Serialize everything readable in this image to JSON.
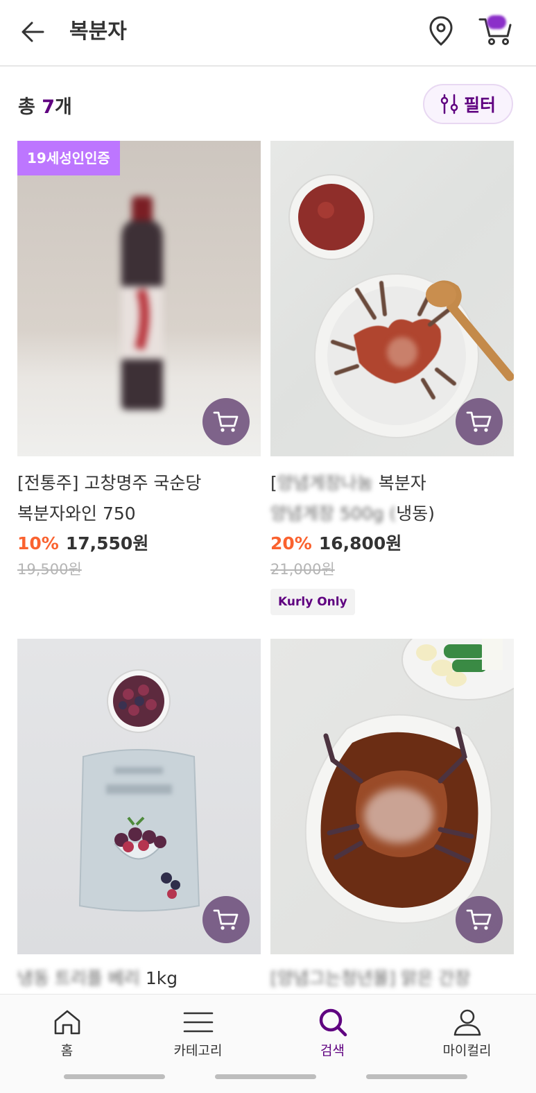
{
  "header": {
    "title": "복분자",
    "back_icon": "back-arrow-icon",
    "location_icon": "location-pin-icon",
    "cart_icon": "cart-icon"
  },
  "summary": {
    "count_prefix": "총 ",
    "count_value": "7",
    "count_suffix": "개",
    "filter_label": "필터"
  },
  "products": [
    {
      "badge": "19세성인인증",
      "name_line1": "[전통주] 고창명주 국순당",
      "name_line2": "복분자와인 750",
      "discount": "10%",
      "price": "17,550원",
      "original_price": "19,500원",
      "tag": "",
      "image": "wine-bottle"
    },
    {
      "badge": "",
      "name_line1": "[",
      "name_line1_visible": "복분자",
      "name_line2_visible": "냉동)",
      "discount": "20%",
      "price": "16,800원",
      "original_price": "21,000원",
      "tag": "Kurly Only",
      "image": "seasoned-crab"
    },
    {
      "badge": "",
      "name_visible": "1kg",
      "image": "frozen-berries"
    },
    {
      "badge": "",
      "image": "soy-crab"
    }
  ],
  "bottom_nav": [
    {
      "label": "홈",
      "icon": "home-icon",
      "active": false
    },
    {
      "label": "카테고리",
      "icon": "menu-icon",
      "active": false
    },
    {
      "label": "검색",
      "icon": "search-icon",
      "active": true
    },
    {
      "label": "마이컬리",
      "icon": "person-icon",
      "active": false
    }
  ],
  "colors": {
    "brand": "#5f0080",
    "discount": "#fa622f",
    "adult_badge": "#bd76ff"
  }
}
